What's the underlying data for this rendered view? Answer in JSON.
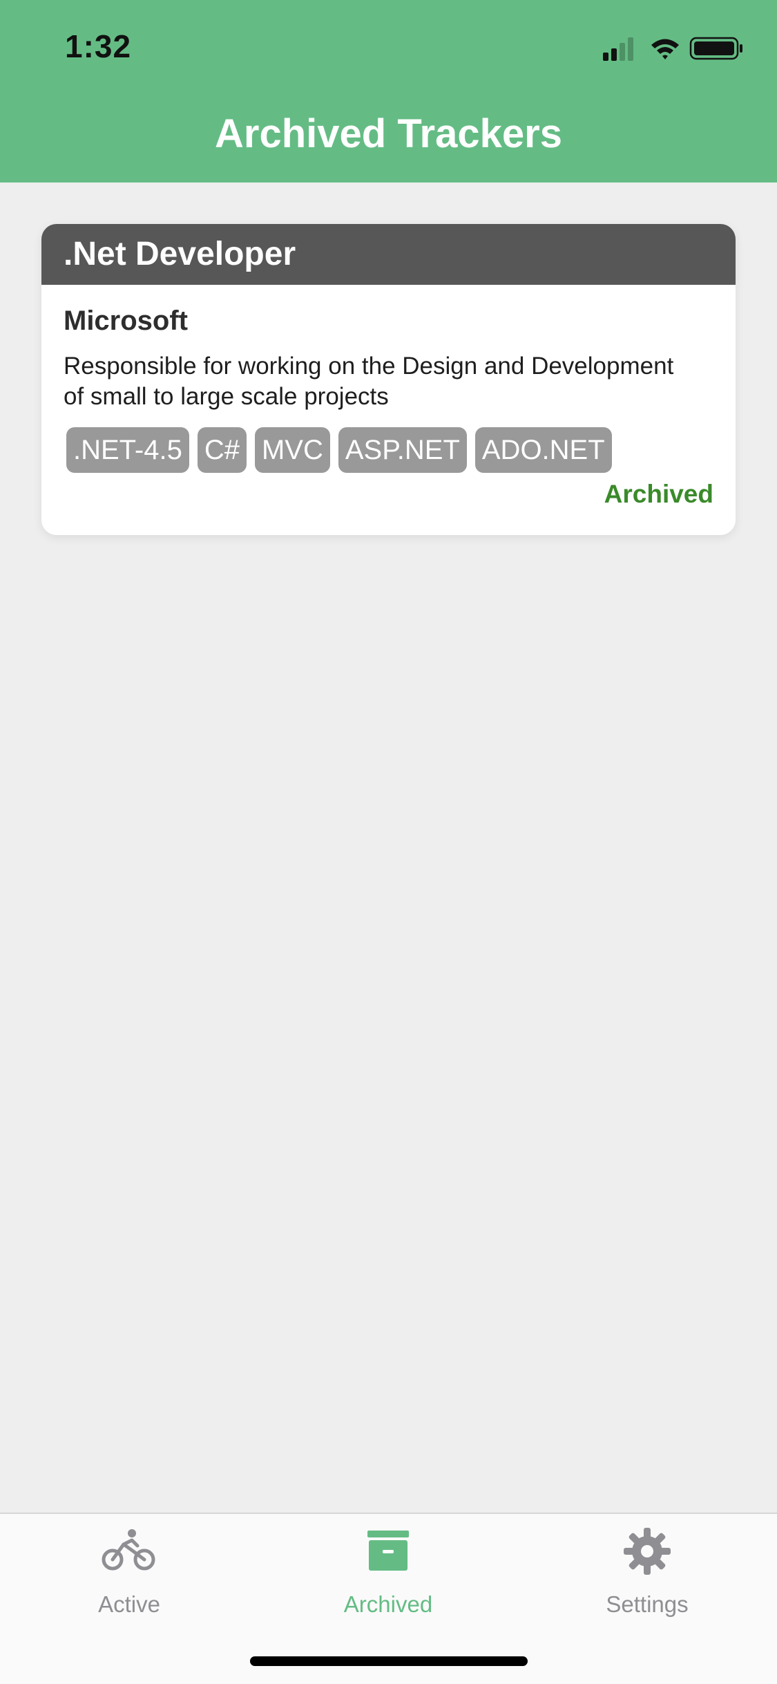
{
  "status_bar": {
    "time": "1:32"
  },
  "header": {
    "title": "Archived Trackers"
  },
  "trackers": [
    {
      "title": ".Net Developer",
      "company": "Microsoft",
      "description": "Responsible for working on the Design and Development of small to large scale projects",
      "tags": [
        ".NET-4.5",
        "C#",
        "MVC",
        "ASP.NET",
        "ADO.NET"
      ],
      "status": "Archived"
    }
  ],
  "tabbar": {
    "active_label": "Active",
    "archived_label": "Archived",
    "settings_label": "Settings",
    "selected": "Archived"
  },
  "colors": {
    "primary": "#64bc84",
    "card_header": "#575757",
    "tag_bg": "#999999",
    "status": "#3a8a2a",
    "tab_inactive": "#8e8e93"
  }
}
